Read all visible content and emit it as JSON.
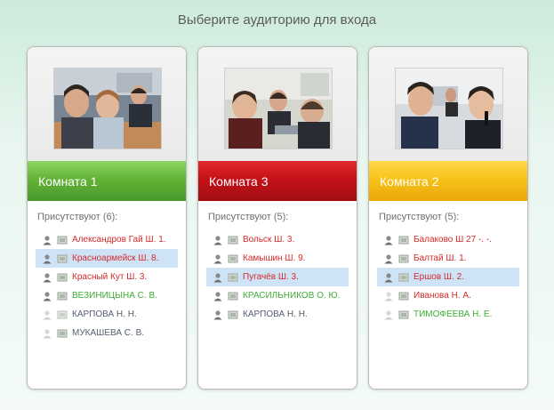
{
  "header": {
    "title": "Выберите аудиторию для входа"
  },
  "rooms": [
    {
      "name": "Комната 1",
      "present_label": "Присутствуют (6):",
      "participants": [
        {
          "name": "Александров Гай Ш. 1.",
          "status": "red",
          "selected": false
        },
        {
          "name": "Красноармейск Ш. 8.",
          "status": "red",
          "selected": true
        },
        {
          "name": "Красный Кут Ш. 3.",
          "status": "red",
          "selected": false
        },
        {
          "name": "ВЕЗИНИЦЫНА С. В.",
          "status": "green",
          "selected": false
        },
        {
          "name": "КАРПОВА Н. Н.",
          "status": "gray",
          "selected": false
        },
        {
          "name": "МУКАШЕВА С. В.",
          "status": "gray",
          "selected": false
        }
      ]
    },
    {
      "name": "Комната 3",
      "present_label": "Присутствуют (5):",
      "participants": [
        {
          "name": "Вольск Ш. 3.",
          "status": "red",
          "selected": false
        },
        {
          "name": "Камышин Ш. 9.",
          "status": "red",
          "selected": false
        },
        {
          "name": "Пугачёв Ш. 3.",
          "status": "red",
          "selected": true
        },
        {
          "name": "КРАСИЛЬНИКОВ О. Ю.",
          "status": "green",
          "selected": false
        },
        {
          "name": "КАРПОВА Н. Н.",
          "status": "gray",
          "selected": false
        }
      ]
    },
    {
      "name": "Комната 2",
      "present_label": "Присутствуют (5):",
      "participants": [
        {
          "name": "Балаково Ш 27 -. -.",
          "status": "red",
          "selected": false
        },
        {
          "name": "Балтай Ш. 1.",
          "status": "red",
          "selected": false
        },
        {
          "name": "Ершов Ш. 2.",
          "status": "red",
          "selected": true
        },
        {
          "name": "Иванова Н. А.",
          "status": "red",
          "selected": false
        },
        {
          "name": "ТИМОФЕЕВА Н. Е.",
          "status": "green",
          "selected": false
        }
      ]
    }
  ],
  "colors": {
    "band_room1": "#5aa932",
    "band_room3": "#c0141b",
    "band_room2": "#f6bb14",
    "name_red": "#d42a2a",
    "name_green": "#3fae36",
    "name_gray": "#555e70",
    "selected_row": "#cfe3f7"
  },
  "icons": {
    "user": "user-icon",
    "camera": "webcam-icon"
  }
}
